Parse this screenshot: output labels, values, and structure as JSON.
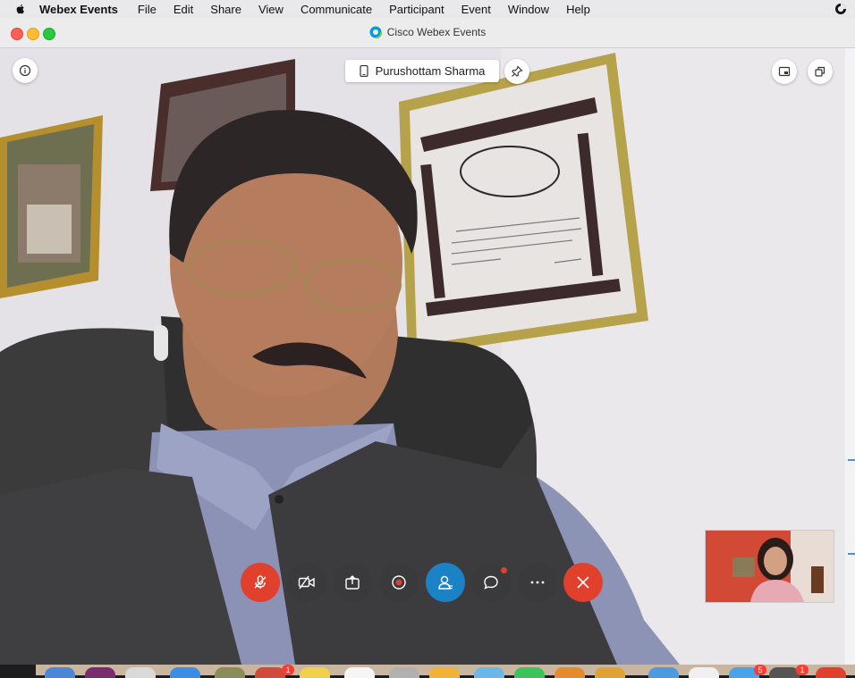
{
  "menubar": {
    "app_name": "Webex Events",
    "items": [
      "File",
      "Edit",
      "Share",
      "View",
      "Communicate",
      "Participant",
      "Event",
      "Window",
      "Help"
    ]
  },
  "window": {
    "title": "Cisco Webex Events",
    "traffic_lights": {
      "close": "#fe5f57",
      "minimize": "#febc2e",
      "zoom": "#28c840"
    }
  },
  "video": {
    "active_speaker": "Purushottam Sharma",
    "speaker_device_icon": "mobile-phone-icon",
    "pin_icon": "pin-icon",
    "info_icon": "info-icon",
    "layout_icon": "layout-icon",
    "popout_icon": "popout-icon"
  },
  "controls": {
    "buttons": [
      {
        "name": "mute-button",
        "icon": "microphone-muted-icon",
        "color": "#e0402c"
      },
      {
        "name": "video-button",
        "icon": "video-camera-off-icon",
        "color": "#3a3a3c"
      },
      {
        "name": "share-button",
        "icon": "share-icon",
        "color": "#3a3a3c"
      },
      {
        "name": "record-button",
        "icon": "record-icon",
        "color": "#3a3a3c"
      },
      {
        "name": "participants-button",
        "icon": "participants-icon",
        "color": "#1b82c5"
      },
      {
        "name": "chat-button",
        "icon": "chat-icon",
        "color": "#3a3a3c"
      },
      {
        "name": "more-options-button",
        "icon": "more-icon",
        "color": "#3a3a3c"
      },
      {
        "name": "leave-button",
        "icon": "close-icon",
        "color": "#e0402c"
      }
    ]
  },
  "dock": {
    "badges": [
      "1",
      "5",
      "1"
    ]
  }
}
